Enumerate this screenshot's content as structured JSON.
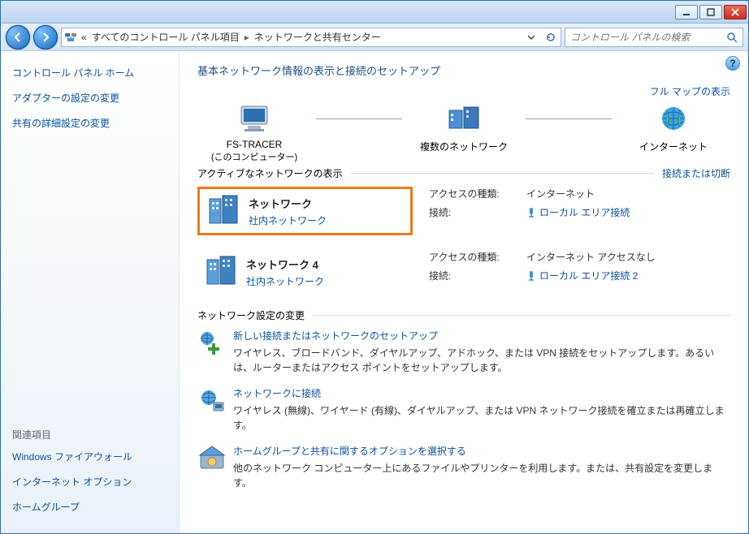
{
  "breadcrumb": {
    "root": "すべてのコントロール パネル項目",
    "current": "ネットワークと共有センター"
  },
  "search_placeholder": "コントロール パネルの検索",
  "sidebar": {
    "home": "コントロール パネル ホーム",
    "adapter": "アダプターの設定の変更",
    "advanced": "共有の詳細設定の変更",
    "related_hdr": "関連項目",
    "firewall": "Windows ファイアウォール",
    "inet_options": "インターネット オプション",
    "homegroup": "ホームグループ"
  },
  "page": {
    "title": "基本ネットワーク情報の表示と接続のセットアップ",
    "full_map": "フル マップの表示",
    "active_hdr": "アクティブなネットワークの表示",
    "connect_disconnect": "接続または切断",
    "settings_hdr": "ネットワーク設定の変更"
  },
  "map": {
    "node1": "FS-TRACER",
    "node1_sub": "(このコンピューター)",
    "node2": "複数のネットワーク",
    "node3": "インターネット"
  },
  "networks": [
    {
      "name": "ネットワーク",
      "category": "社内ネットワーク",
      "access_label": "アクセスの種類:",
      "access_value": "インターネット",
      "conn_label": "接続:",
      "conn_link": "ローカル エリア接続"
    },
    {
      "name": "ネットワーク 4",
      "category": "社内ネットワーク",
      "access_label": "アクセスの種類:",
      "access_value": "インターネット アクセスなし",
      "conn_label": "接続:",
      "conn_link": "ローカル エリア接続 2"
    }
  ],
  "tasks": [
    {
      "link": "新しい接続またはネットワークのセットアップ",
      "desc": "ワイヤレス、ブロードバンド、ダイヤルアップ、アドホック、または VPN 接続をセットアップします。あるいは、ルーターまたはアクセス ポイントをセットアップします。"
    },
    {
      "link": "ネットワークに接続",
      "desc": "ワイヤレス (無線)、ワイヤード (有線)、ダイヤルアップ、または VPN ネットワーク接続を確立または再確立します。"
    },
    {
      "link": "ホームグループと共有に関するオプションを選択する",
      "desc": "他のネットワーク コンピューター上にあるファイルやプリンターを利用します。または、共有設定を変更します。"
    }
  ]
}
